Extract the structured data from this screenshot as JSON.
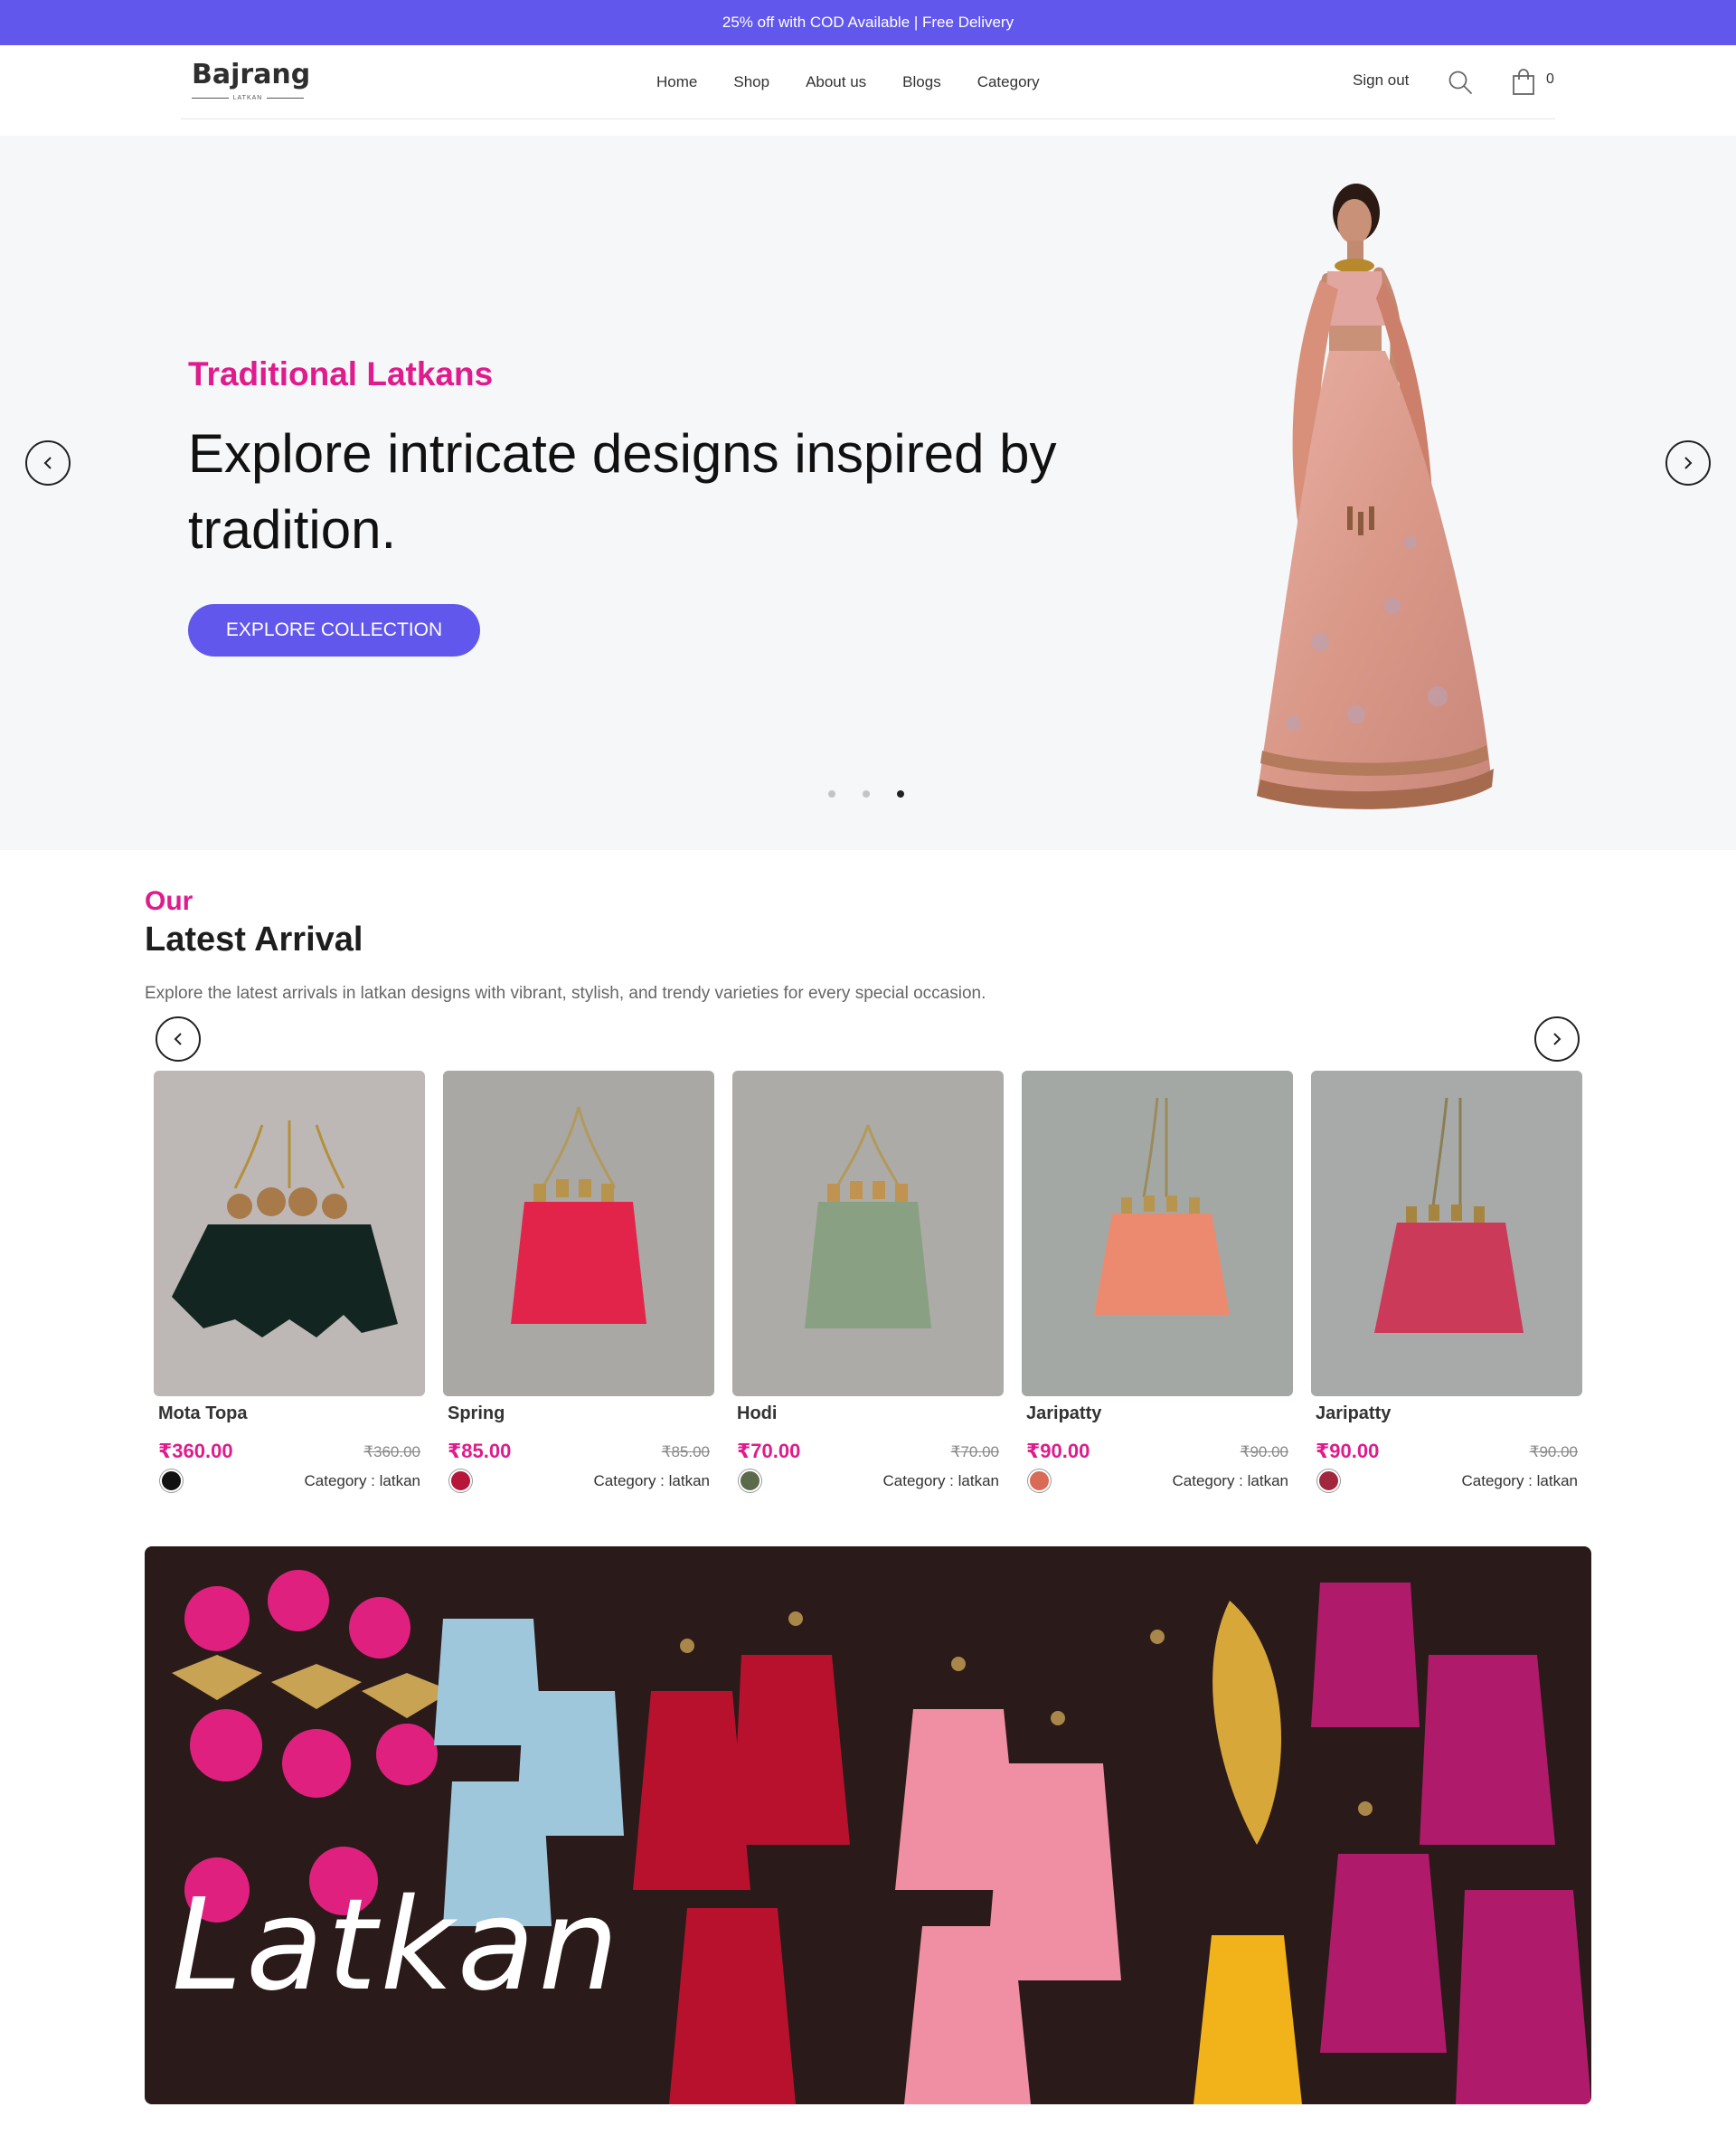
{
  "announcement": "25% off with COD Available | Free Delivery",
  "brand": {
    "name": "Bajrang",
    "tagline": "LATKAN"
  },
  "nav": {
    "items": [
      "Home",
      "Shop",
      "About us",
      "Blogs",
      "Category"
    ]
  },
  "account": {
    "signout_label": "Sign out",
    "cart_count": "0"
  },
  "icons": {
    "search": "search-icon",
    "cart": "shopping-bag-icon",
    "prev": "chevron-left-icon",
    "next": "chevron-right-icon"
  },
  "hero": {
    "subtitle": "Traditional Latkans",
    "title": "Explore intricate designs inspired by tradition.",
    "cta": "EXPLORE COLLECTION",
    "slide_count": 3,
    "active_slide": 3
  },
  "latest": {
    "kicker": "Our",
    "title": "Latest Arrival",
    "description": "Explore the latest arrivals in latkan designs with vibrant, stylish, and trendy varieties for every special occasion.",
    "products": [
      {
        "name": "Mota Topa",
        "price": "₹360.00",
        "old_price": "₹360.00",
        "category": "Category : latkan",
        "swatch": "#111111"
      },
      {
        "name": "Spring",
        "price": "₹85.00",
        "old_price": "₹85.00",
        "category": "Category : latkan",
        "swatch": "#b5163a"
      },
      {
        "name": "Hodi",
        "price": "₹70.00",
        "old_price": "₹70.00",
        "category": "Category : latkan",
        "swatch": "#5c6a4c"
      },
      {
        "name": "Jaripatty",
        "price": "₹90.00",
        "old_price": "₹90.00",
        "category": "Category : latkan",
        "swatch": "#d96a55"
      },
      {
        "name": "Jaripatty",
        "price": "₹90.00",
        "old_price": "₹90.00",
        "category": "Category : latkan",
        "swatch": "#a2273e"
      }
    ]
  },
  "banner": {
    "text": "Latkan"
  },
  "colors": {
    "accent": "#6257ec",
    "pink": "#df1b8d",
    "hero_bg": "#f6f7f9"
  }
}
